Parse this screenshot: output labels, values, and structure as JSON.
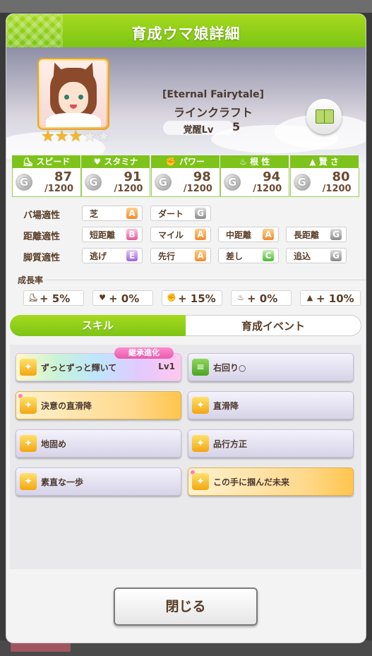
{
  "header": {
    "title": "育成ウマ娘詳細"
  },
  "character": {
    "outfit": "[Eternal Fairytale]",
    "name": "ラインクラフト",
    "stars_on": 3,
    "stars_total": 5,
    "awaken_label": "覚醒Lv",
    "awaken_value": "5"
  },
  "stats": [
    {
      "label": "スピード",
      "icon": "shoe-icon",
      "value": "87",
      "max": "/1200"
    },
    {
      "label": "スタミナ",
      "icon": "heart-icon",
      "value": "91",
      "max": "/1200"
    },
    {
      "label": "パワー",
      "icon": "muscle-icon",
      "value": "98",
      "max": "/1200"
    },
    {
      "label": "根 性",
      "icon": "flame-icon",
      "value": "94",
      "max": "/1200"
    },
    {
      "label": "賢 さ",
      "icon": "graduation-cap-icon",
      "value": "80",
      "max": "/1200"
    }
  ],
  "stat_rank": "G",
  "aptitudes": {
    "track": {
      "label": "バ場適性",
      "items": [
        {
          "name": "芝",
          "grade": "A"
        },
        {
          "name": "ダート",
          "grade": "G"
        }
      ]
    },
    "distance": {
      "label": "距離適性",
      "items": [
        {
          "name": "短距離",
          "grade": "B"
        },
        {
          "name": "マイル",
          "grade": "A"
        },
        {
          "name": "中距離",
          "grade": "A"
        },
        {
          "name": "長距離",
          "grade": "G"
        }
      ]
    },
    "style": {
      "label": "脚質適性",
      "items": [
        {
          "name": "逃げ",
          "grade": "E"
        },
        {
          "name": "先行",
          "grade": "A"
        },
        {
          "name": "差し",
          "grade": "C"
        },
        {
          "name": "追込",
          "grade": "G"
        }
      ]
    }
  },
  "growth": {
    "title": "成長率",
    "items": [
      {
        "value": "+ 5%"
      },
      {
        "value": "+ 0%"
      },
      {
        "value": "+ 15%"
      },
      {
        "value": "+ 0%"
      },
      {
        "value": "+ 10%"
      }
    ]
  },
  "tabs": [
    {
      "label": "スキル",
      "active": true
    },
    {
      "label": "育成イベント",
      "active": false
    }
  ],
  "skills": [
    {
      "name": "ずっとずっと輝いて",
      "lv": "Lv1",
      "style": "rainbow",
      "badge": "継承進化"
    },
    {
      "name": "右回り○",
      "style": "normal",
      "icon": "green"
    },
    {
      "name": "決意の直滑降",
      "style": "gold",
      "dot": true
    },
    {
      "name": "直滑降",
      "style": "normal"
    },
    {
      "name": "地固め",
      "style": "normal"
    },
    {
      "name": "品行方正",
      "style": "normal"
    },
    {
      "name": "素直な一歩",
      "style": "normal"
    },
    {
      "name": "この手に掴んだ未来",
      "style": "gold",
      "dot": true
    }
  ],
  "close_label": "閉じる",
  "colors": {
    "accent_green": "#7cc414",
    "text_brown": "#5a3d28"
  }
}
